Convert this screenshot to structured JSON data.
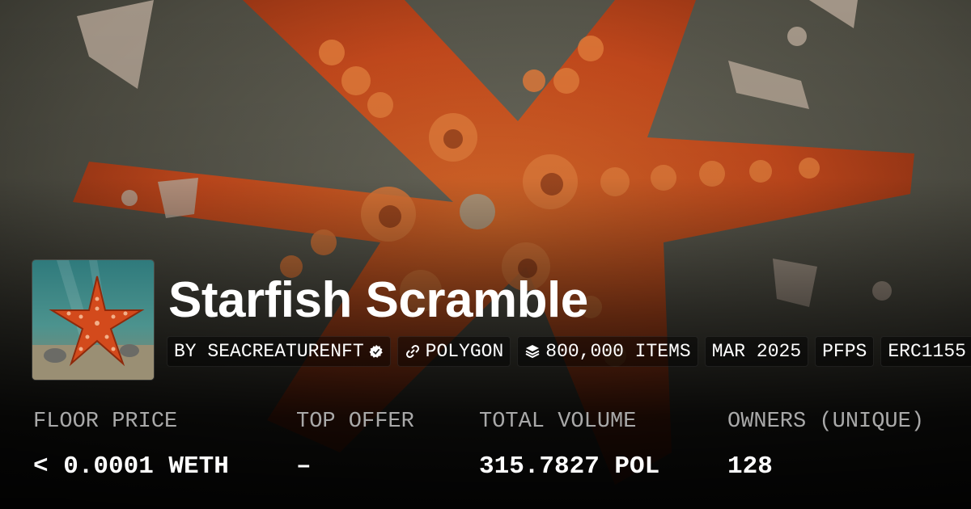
{
  "collection": {
    "name": "Starfish Scramble",
    "creator": "BY SEACREATURENFT",
    "chain": "POLYGON",
    "items": "800,000 ITEMS",
    "date": "MAR 2025",
    "category": "PFPS",
    "standard": "ERC1155",
    "verified_icon": "verified-badge-icon",
    "chain_icon": "link-icon",
    "items_icon": "layers-icon"
  },
  "stats": {
    "floor_price": {
      "label": "FLOOR PRICE",
      "value": "< 0.0001 WETH"
    },
    "top_offer": {
      "label": "TOP OFFER",
      "value": "–"
    },
    "total_volume": {
      "label": "TOTAL VOLUME",
      "value": "315.7827 POL"
    },
    "owners": {
      "label": "OWNERS (UNIQUE)",
      "value": "128"
    }
  },
  "colors": {
    "starfish": "#c8501e",
    "sand": "#8a8676",
    "label_gray": "#a9a9a9"
  }
}
